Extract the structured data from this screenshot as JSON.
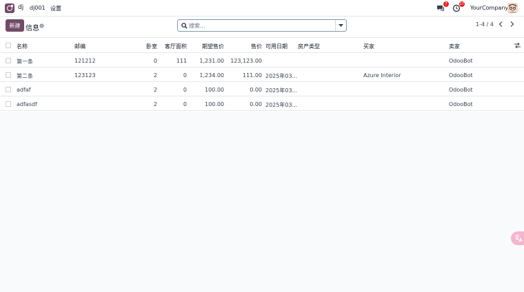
{
  "navbar": {
    "app_name": "dj",
    "menus": [
      "dj001",
      "设置"
    ],
    "messages_count": "7",
    "activities_count": "17",
    "company": "YourCompany"
  },
  "control": {
    "new_label": "新建",
    "breadcrumb": "信息",
    "search_placeholder": "搜索...",
    "pager": "1-4 / 4"
  },
  "table": {
    "columns": [
      "名称",
      "邮编",
      "卧室",
      "客厅面积",
      "期望售价",
      "售价",
      "可用日期",
      "房产类型",
      "买家",
      "卖家"
    ],
    "rows": [
      [
        "第一条",
        "121212",
        "0",
        "111",
        "1,231.00",
        "123,123.00",
        "",
        "",
        "",
        "OdooBot"
      ],
      [
        "第二条",
        "123123",
        "2",
        "0",
        "1,234.00",
        "111.00",
        "2025年03...",
        "",
        "Azure Interior",
        "OdooBot"
      ],
      [
        "adfaf",
        "",
        "2",
        "0",
        "100.00",
        "0.00",
        "2025年03...",
        "",
        "",
        "OdooBot"
      ],
      [
        "adfasdf",
        "",
        "2",
        "0",
        "100.00",
        "0.00",
        "2025年03...",
        "",
        "",
        "OdooBot"
      ]
    ]
  },
  "colors": {
    "brand": "#714b67",
    "badge": "#dc2626",
    "float": "#f4b6cf"
  }
}
